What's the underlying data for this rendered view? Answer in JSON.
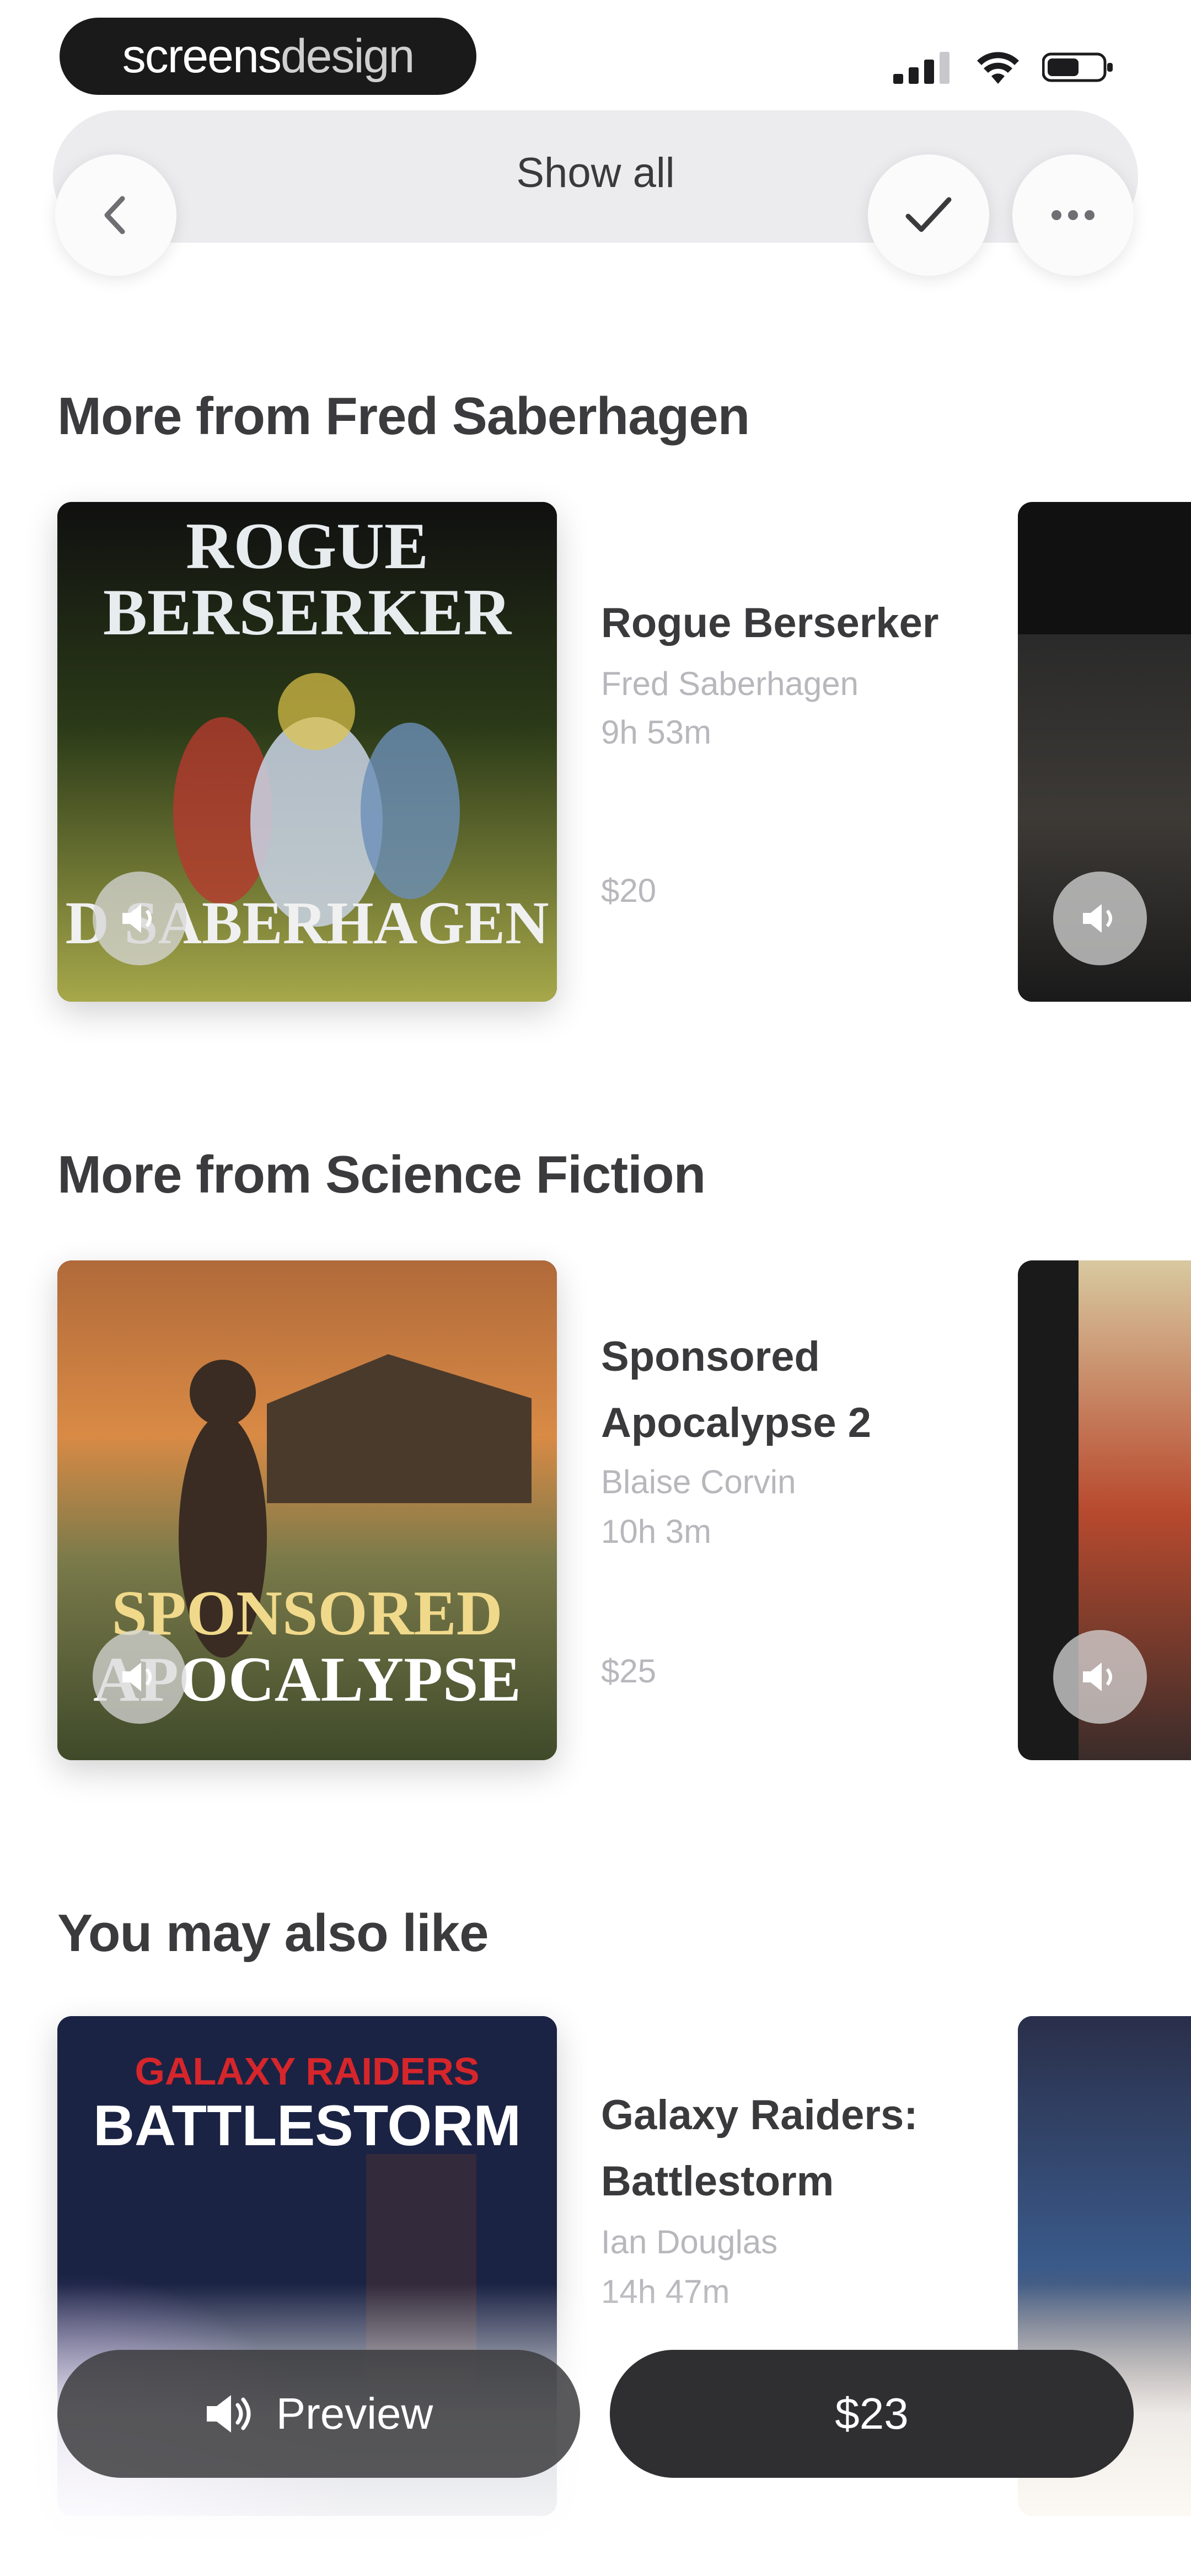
{
  "statusbar": {
    "logo_bold": "screens",
    "logo_light": "design"
  },
  "nav": {
    "title": "Show all",
    "back_icon": "chevron-left-icon",
    "check_icon": "checkmark-icon",
    "more_icon": "ellipsis-icon"
  },
  "sections": [
    {
      "title": "More from Fred Saberhagen",
      "book": {
        "title": "Rogue Berserker",
        "author": "Fred Saberhagen",
        "duration": "9h 53m",
        "price": "$20",
        "cover_line1": "ROGUE",
        "cover_line2": "BERSERKER",
        "cover_line3": "D SABERHAGEN"
      }
    },
    {
      "title": "More from Science Fiction",
      "book": {
        "title": "Sponsored Apocalypse 2",
        "author": "Blaise Corvin",
        "duration": "10h 3m",
        "price": "$25",
        "cover_line1": "SPONSORED",
        "cover_line2": "APOCALYPSE"
      }
    },
    {
      "title": "You may also like",
      "book": {
        "title": "Galaxy Raiders: Battlestorm",
        "author": "Ian Douglas",
        "duration": "14h 47m",
        "cover_line1": "GALAXY RAIDERS",
        "cover_line2": "BATTLESTORM"
      }
    }
  ],
  "bottom": {
    "preview_label": "Preview",
    "price_label": "$23"
  },
  "colors": {
    "accent_dark": "#2f2f31",
    "muted_text": "#b7b7bc"
  }
}
